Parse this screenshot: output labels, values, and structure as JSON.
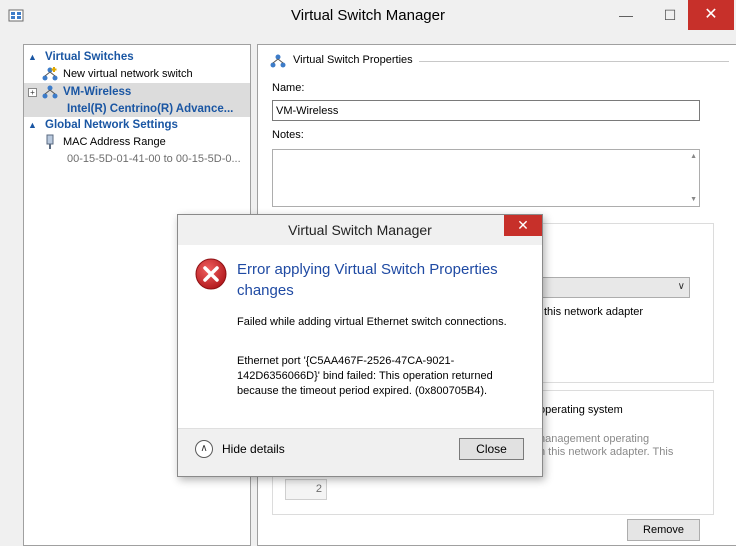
{
  "window": {
    "title": "Virtual Switch Manager",
    "minimize_glyph": "—",
    "maximize_glyph": "☐",
    "close_glyph": "✕"
  },
  "left_pane": {
    "virtual_switches_header": "Virtual Switches",
    "new_switch_label": "New virtual network switch",
    "vm_switch": {
      "name": "VM-Wireless",
      "adapter": "Intel(R) Centrino(R) Advance..."
    },
    "global_settings_header": "Global Network Settings",
    "mac_range": {
      "label": "MAC Address Range",
      "value": "00-15-5D-01-41-00 to 00-15-5D-0..."
    }
  },
  "right_pane": {
    "header": "Virtual Switch Properties",
    "name_label": "Name:",
    "name_value": "VM-Wireless",
    "notes_label": "Notes:",
    "partial_adapter_text": "this network adapter",
    "partial_os_text": "operating system",
    "partial_mgmt_line1": "nanagement operating",
    "partial_mgmt_line2": "n this network adapter. This",
    "vlan_id_value": "2",
    "remove_label": "Remove"
  },
  "dialog": {
    "title": "Virtual Switch Manager",
    "close_glyph": "✕",
    "heading": "Error applying Virtual Switch Properties changes",
    "message1": "Failed while adding virtual Ethernet switch connections.",
    "message2": "Ethernet port '{C5AA467F-2526-47CA-9021-142D6356066D}' bind failed: This operation returned because the timeout period expired. (0x800705B4).",
    "hide_details_label": "Hide details",
    "close_button_label": "Close"
  },
  "colors": {
    "accent_blue": "#1a56a3",
    "heading_blue": "#1f4aa3",
    "close_red": "#c7302a",
    "error_red": "#c8262a"
  }
}
